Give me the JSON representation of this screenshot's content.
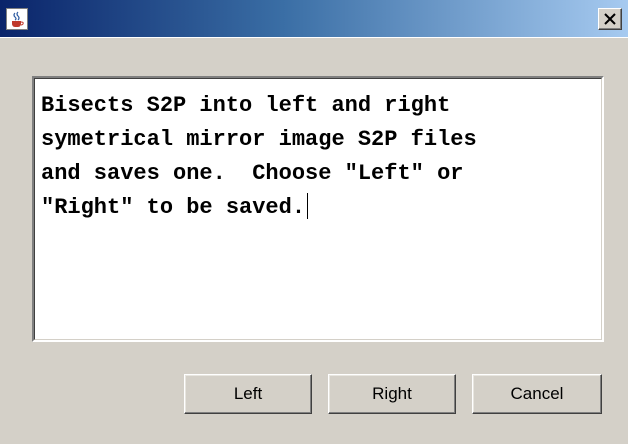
{
  "window": {
    "title": "",
    "icon": "java-cup-icon",
    "close_glyph": "✕"
  },
  "message": {
    "text": "Bisects S2P into left and right\nsymetrical mirror image S2P files\nand saves one.  Choose \"Left\" or\n\"Right\" to be saved."
  },
  "buttons": {
    "left_label": "Left",
    "right_label": "Right",
    "cancel_label": "Cancel"
  }
}
